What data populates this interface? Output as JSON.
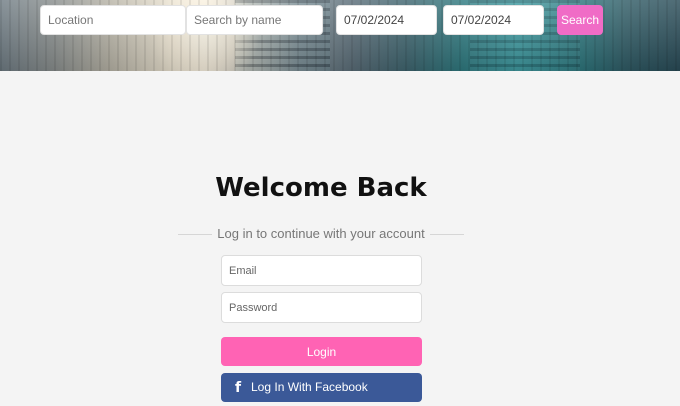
{
  "search_bar": {
    "location_placeholder": "Location",
    "name_placeholder": "Search by name",
    "check_in_value": "07/02/2024",
    "check_out_value": "07/02/2024",
    "search_label": "Search"
  },
  "login": {
    "title": "Welcome Back",
    "subtitle": "Log in to continue with your account",
    "email_placeholder": "Email",
    "password_placeholder": "Password",
    "login_label": "Login",
    "facebook_label": "Log In With Facebook",
    "facebook_icon": "facebook-icon"
  },
  "colors": {
    "search_button": "#f06cc6",
    "login_button": "#ff63b4",
    "facebook_button": "#3b5998",
    "page_background": "#f4f4f4"
  }
}
